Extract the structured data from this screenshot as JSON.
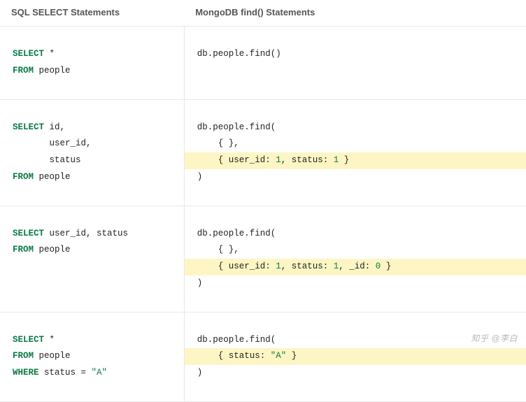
{
  "headers": {
    "sql": "SQL SELECT Statements",
    "mongo": "MongoDB find() Statements"
  },
  "kw": {
    "select": "SELECT",
    "from": "FROM",
    "where": "WHERE"
  },
  "rows": [
    {
      "sql": {
        "select_rest": " *",
        "from_rest": " people"
      },
      "mongo": {
        "l0": "db.people.find()"
      }
    },
    {
      "sql": {
        "select_rest": " id,",
        "l1": "       user_id,",
        "l2": "       status",
        "from_rest": " people"
      },
      "mongo": {
        "l0": "db.people.find(",
        "l1": "    { },",
        "l2_pre": "    { user_id: ",
        "l2_n1": "1",
        "l2_mid": ", status: ",
        "l2_n2": "1",
        "l2_suf": " }",
        "l3": ")"
      }
    },
    {
      "sql": {
        "select_rest": " user_id, status",
        "from_rest": " people"
      },
      "mongo": {
        "l0": "db.people.find(",
        "l1": "    { },",
        "l2_pre": "    { user_id: ",
        "l2_n1": "1",
        "l2_mid1": ", status: ",
        "l2_n2": "1",
        "l2_mid2": ", _id: ",
        "l2_n3": "0",
        "l2_suf": " }",
        "l3": ")"
      }
    },
    {
      "sql": {
        "select_rest": " *",
        "from_rest": " people",
        "where_rest": " status = ",
        "where_str": "\"A\""
      },
      "mongo": {
        "l0": "db.people.find(",
        "l1_pre": "    { status: ",
        "l1_str": "\"A\"",
        "l1_suf": " }",
        "l2": ")"
      }
    }
  ],
  "watermark": "知乎 @李白"
}
